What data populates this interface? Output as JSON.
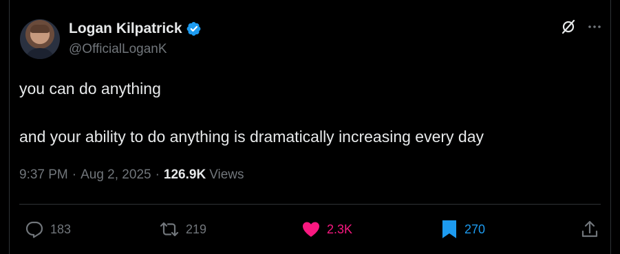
{
  "author": {
    "name": "Logan Kilpatrick",
    "handle": "@OfficialLoganK",
    "verified": true
  },
  "tweet": {
    "line1": "you can do anything",
    "line2": "and your ability to do anything is dramatically increasing every day"
  },
  "meta": {
    "time": "9:37 PM",
    "separator1": "·",
    "date": "Aug 2, 2025",
    "separator2": "·",
    "views_count": "126.9K",
    "views_label": "Views"
  },
  "actions": {
    "replies": "183",
    "reposts": "219",
    "likes": "2.3K",
    "bookmarks": "270"
  },
  "icons": {
    "verified": "verified-badge-icon",
    "grok": "grok-icon",
    "more": "more-icon",
    "reply": "reply-icon",
    "repost": "repost-icon",
    "like": "heart-icon",
    "bookmark": "bookmark-icon",
    "share": "share-icon"
  },
  "colors": {
    "background": "#000000",
    "text": "#e7e9ea",
    "secondary": "#71767b",
    "like": "#f91880",
    "bookmark": "#1d9bf0",
    "verified": "#1d9bf0"
  }
}
